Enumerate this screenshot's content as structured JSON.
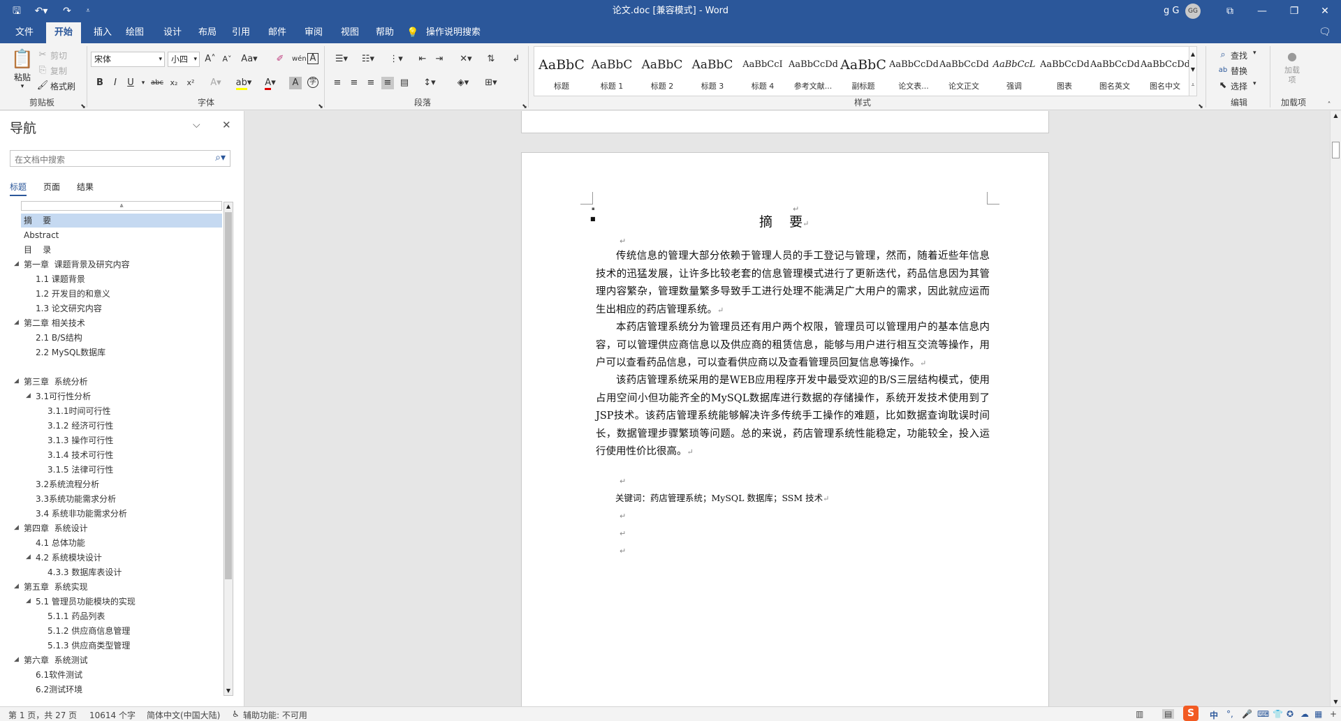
{
  "title_bar": {
    "doc_title": "论文.doc [兼容模式] - Word",
    "user_name": "g G",
    "avatar_initials": "GG",
    "quick_access_icons": [
      "save-icon",
      "undo-icon",
      "redo-icon",
      "customize-icon"
    ]
  },
  "tabs": [
    "文件",
    "开始",
    "插入",
    "绘图",
    "设计",
    "布局",
    "引用",
    "邮件",
    "审阅",
    "视图",
    "帮助"
  ],
  "active_tab": "开始",
  "tell_me": "操作说明搜索",
  "ribbon": {
    "clipboard": {
      "paste": "粘贴",
      "cut": "剪切",
      "copy": "复制",
      "format_painter": "格式刷",
      "label": "剪贴板"
    },
    "font": {
      "name": "宋体",
      "size": "小四",
      "label": "字体"
    },
    "paragraph": {
      "label": "段落"
    },
    "styles": {
      "label": "样式",
      "items": [
        {
          "sample": "AaBbC",
          "name": "标题"
        },
        {
          "sample": "AaBbC",
          "name": "标题 1"
        },
        {
          "sample": "AaBbC",
          "name": "标题 2"
        },
        {
          "sample": "AaBbC",
          "name": "标题 3"
        },
        {
          "sample": "AaBbCcI",
          "name": "标题 4"
        },
        {
          "sample": "AaBbCcDdI",
          "name": "参考文献..."
        },
        {
          "sample": "AaBbC",
          "name": "副标题"
        },
        {
          "sample": "AaBbCcDd",
          "name": "论文表..."
        },
        {
          "sample": "AaBbCcDd",
          "name": "论文正文"
        },
        {
          "sample": "AaBbCcL",
          "name": "强调"
        },
        {
          "sample": "AaBbCcDd",
          "name": "图表"
        },
        {
          "sample": "AaBbCcDd",
          "name": "图名英文"
        },
        {
          "sample": "AaBbCcDdI",
          "name": "图名中文"
        }
      ]
    },
    "editing": {
      "find": "查找",
      "replace": "替换",
      "select": "选择",
      "label": "编辑"
    },
    "addins": {
      "button": "加载项",
      "label": "加载项"
    }
  },
  "nav": {
    "title": "导航",
    "search_placeholder": "在文档中搜索",
    "tabs": [
      "标题",
      "页面",
      "结果"
    ],
    "items": [
      {
        "text": "摘    要",
        "level": 0,
        "selected": true,
        "caret": false
      },
      {
        "text": "Abstract",
        "level": 0,
        "caret": false
      },
      {
        "text": "目    录",
        "level": 0,
        "caret": false
      },
      {
        "text": "第一章  课题背景及研究内容",
        "level": 0,
        "caret": true
      },
      {
        "text": "1.1 课题背景",
        "level": 1,
        "caret": false
      },
      {
        "text": "1.2 开发目的和意义",
        "level": 1,
        "caret": false
      },
      {
        "text": "1.3 论文研究内容",
        "level": 1,
        "caret": false
      },
      {
        "text": "第二章 相关技术",
        "level": 0,
        "caret": true
      },
      {
        "text": "2.1 B/S结构",
        "level": 1,
        "caret": false
      },
      {
        "text": "2.2 MySQL数据库",
        "level": 1,
        "caret": false
      },
      {
        "text": "",
        "level": 0,
        "caret": false
      },
      {
        "text": "第三章  系统分析",
        "level": 0,
        "caret": true
      },
      {
        "text": "3.1可行性分析",
        "level": 1,
        "caret": true
      },
      {
        "text": "3.1.1时间可行性",
        "level": 2,
        "caret": false
      },
      {
        "text": "3.1.2 经济可行性",
        "level": 2,
        "caret": false
      },
      {
        "text": "3.1.3 操作可行性",
        "level": 2,
        "caret": false
      },
      {
        "text": "3.1.4 技术可行性",
        "level": 2,
        "caret": false
      },
      {
        "text": "3.1.5 法律可行性",
        "level": 2,
        "caret": false
      },
      {
        "text": "3.2系统流程分析",
        "level": 1,
        "caret": false
      },
      {
        "text": "3.3系统功能需求分析",
        "level": 1,
        "caret": false
      },
      {
        "text": "3.4 系统非功能需求分析",
        "level": 1,
        "caret": false
      },
      {
        "text": "第四章  系统设计",
        "level": 0,
        "caret": true
      },
      {
        "text": "4.1 总体功能",
        "level": 1,
        "caret": false
      },
      {
        "text": "4.2 系统模块设计",
        "level": 1,
        "caret": true
      },
      {
        "text": "4.3.3 数据库表设计",
        "level": 2,
        "caret": false
      },
      {
        "text": "第五章  系统实现",
        "level": 0,
        "caret": true
      },
      {
        "text": "5.1 管理员功能模块的实现",
        "level": 1,
        "caret": true
      },
      {
        "text": "5.1.1 药品列表",
        "level": 2,
        "caret": false
      },
      {
        "text": "5.1.2 供应商信息管理",
        "level": 2,
        "caret": false
      },
      {
        "text": "5.1.3 供应商类型管理",
        "level": 2,
        "caret": false
      },
      {
        "text": "第六章  系统测试",
        "level": 0,
        "caret": true
      },
      {
        "text": "6.1软件测试",
        "level": 1,
        "caret": false
      },
      {
        "text": "6.2测试环境",
        "level": 1,
        "caret": false
      }
    ]
  },
  "document": {
    "heading": "摘    要",
    "paragraphs": [
      "传统信息的管理大部分依赖于管理人员的手工登记与管理，然而，随着近些年信息技术的迅猛发展，让许多比较老套的信息管理模式进行了更新迭代，药品信息因为其管理内容繁杂，管理数量繁多导致手工进行处理不能满足广大用户的需求，因此就应运而生出相应的药店管理系统。",
      "本药店管理系统分为管理员还有用户两个权限，管理员可以管理用户的基本信息内容，可以管理供应商信息以及供应商的租赁信息，能够与用户进行相互交流等操作，用户可以查看药品信息，可以查看供应商以及查看管理员回复信息等操作。",
      "该药店管理系统采用的是WEB应用程序开发中最受欢迎的B/S三层结构模式，使用占用空间小但功能齐全的MySQL数据库进行数据的存储操作，系统开发技术使用到了JSP技术。该药店管理系统能够解决许多传统手工操作的难题，比如数据查询耽误时间长，数据管理步骤繁琐等问题。总的来说，药店管理系统性能稳定，功能较全，投入运行使用性价比很高。"
    ],
    "keywords": "关键词：药店管理系统；MySQL 数据库；SSM 技术",
    "return_mark": "↵"
  },
  "status_bar": {
    "page": "第 1 页，共 27 页",
    "words": "10614 个字",
    "language": "简体中文(中国大陆)",
    "accessibility": "辅助功能: 不可用"
  },
  "ime": {
    "mode": "中"
  },
  "colors": {
    "brand": "#2b579a",
    "nav_selected": "#c5d9f1",
    "highlight": "#ffff00",
    "font_color": "#e00000"
  }
}
